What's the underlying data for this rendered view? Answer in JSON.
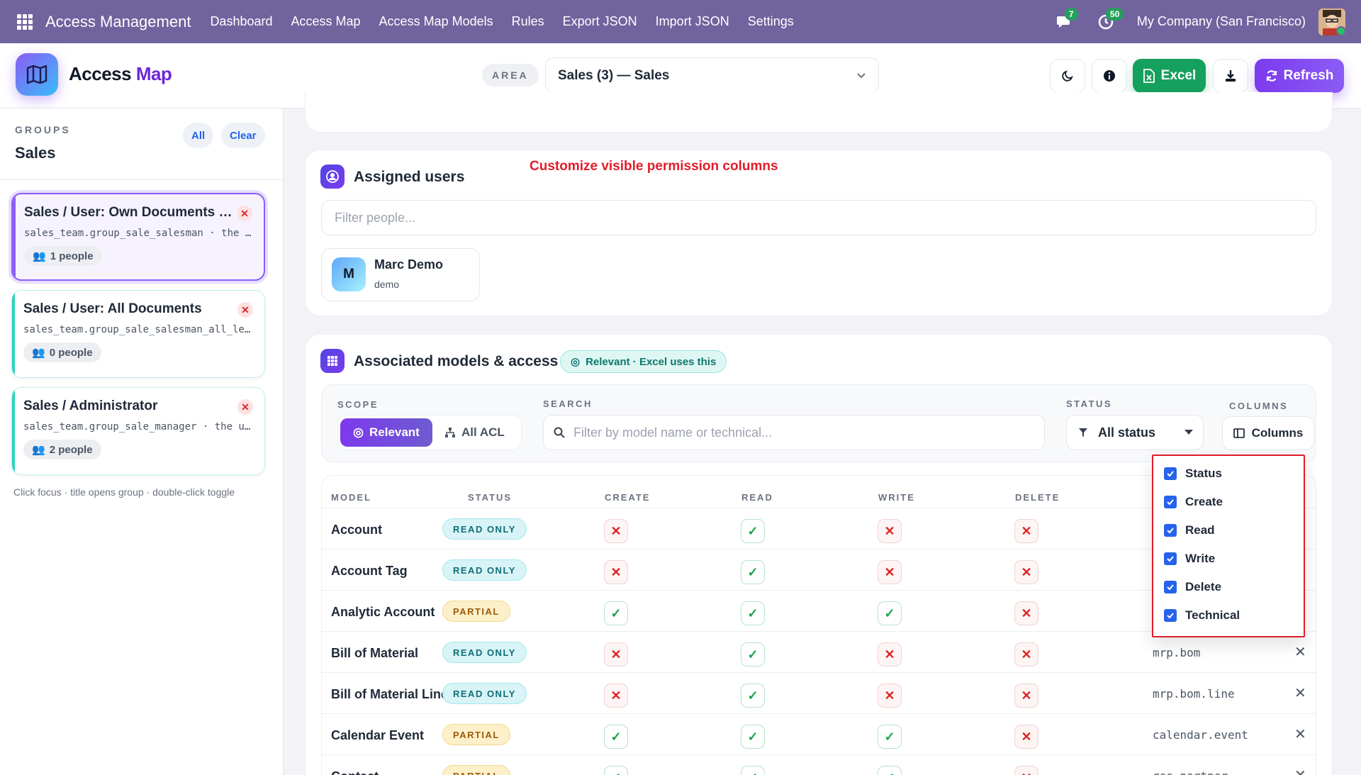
{
  "nav": {
    "brand": "Access Management",
    "links": [
      "Dashboard",
      "Access Map",
      "Access Map Models",
      "Rules",
      "Export JSON",
      "Import JSON",
      "Settings"
    ],
    "messages_count": "7",
    "activity_count": "50",
    "company": "My Company (San Francisco)"
  },
  "header": {
    "title_part1": "Access",
    "title_part2": "Map",
    "area_label": "AREA",
    "area_value": "Sales (3) — Sales",
    "excel_label": "Excel",
    "refresh_label": "Refresh"
  },
  "sidebar": {
    "groups_label": "GROUPS",
    "groups_name": "Sales",
    "all_label": "All",
    "clear_label": "Clear",
    "groups": [
      {
        "name": "Sales / User: Own Documents Only",
        "technical": "sales_team.group_sale_salesman · the user will have access to his own data",
        "people": "1 people",
        "active": true
      },
      {
        "name": "Sales / User: All Documents",
        "technical": "sales_team.group_sale_salesman_all_leads",
        "people": "0 people",
        "active": false
      },
      {
        "name": "Sales / Administrator",
        "technical": "sales_team.group_sale_manager · the user will have an access to the sales configuration",
        "people": "2 people",
        "active": false
      }
    ],
    "hint": "Click focus · title opens group · double-click toggle"
  },
  "users": {
    "title": "Assigned users",
    "annotation": "Customize visible permission columns",
    "filter_placeholder": "Filter people...",
    "list": [
      {
        "initial": "M",
        "name": "Marc Demo",
        "login": "demo"
      }
    ]
  },
  "models": {
    "title": "Associated models & access",
    "badge": "Relevant · Excel uses this",
    "scope_label": "SCOPE",
    "scope_relevant": "Relevant",
    "scope_all": "All ACL",
    "search_label": "SEARCH",
    "search_placeholder": "Filter by model name or technical...",
    "status_label": "STATUS",
    "status_value": "All status",
    "columns_label": "COLUMNS",
    "columns_button": "Columns",
    "headers": [
      "MODEL",
      "STATUS",
      "CREATE",
      "READ",
      "WRITE",
      "DELETE"
    ],
    "rows": [
      {
        "model": "Account",
        "status": "READ ONLY",
        "create": false,
        "read": true,
        "write": false,
        "delete": false,
        "technical": ""
      },
      {
        "model": "Account Tag",
        "status": "READ ONLY",
        "create": false,
        "read": true,
        "write": false,
        "delete": false,
        "technical": ""
      },
      {
        "model": "Analytic Account",
        "status": "PARTIAL",
        "create": true,
        "read": true,
        "write": true,
        "delete": false,
        "technical": ""
      },
      {
        "model": "Bill of Material",
        "status": "READ ONLY",
        "create": false,
        "read": true,
        "write": false,
        "delete": false,
        "technical": "mrp.bom"
      },
      {
        "model": "Bill of Material Line",
        "status": "READ ONLY",
        "create": false,
        "read": true,
        "write": false,
        "delete": false,
        "technical": "mrp.bom.line"
      },
      {
        "model": "Calendar Event",
        "status": "PARTIAL",
        "create": true,
        "read": true,
        "write": true,
        "delete": false,
        "technical": "calendar.event"
      },
      {
        "model": "Contact",
        "status": "PARTIAL",
        "create": true,
        "read": true,
        "write": true,
        "delete": false,
        "technical": "res.partner"
      }
    ],
    "column_menu": [
      "Status",
      "Create",
      "Read",
      "Write",
      "Delete",
      "Technical"
    ]
  },
  "colors": {
    "nav": "#71639e",
    "accent": "#7c3aed",
    "excel": "#16a05e",
    "annotation": "#e11d2a"
  }
}
